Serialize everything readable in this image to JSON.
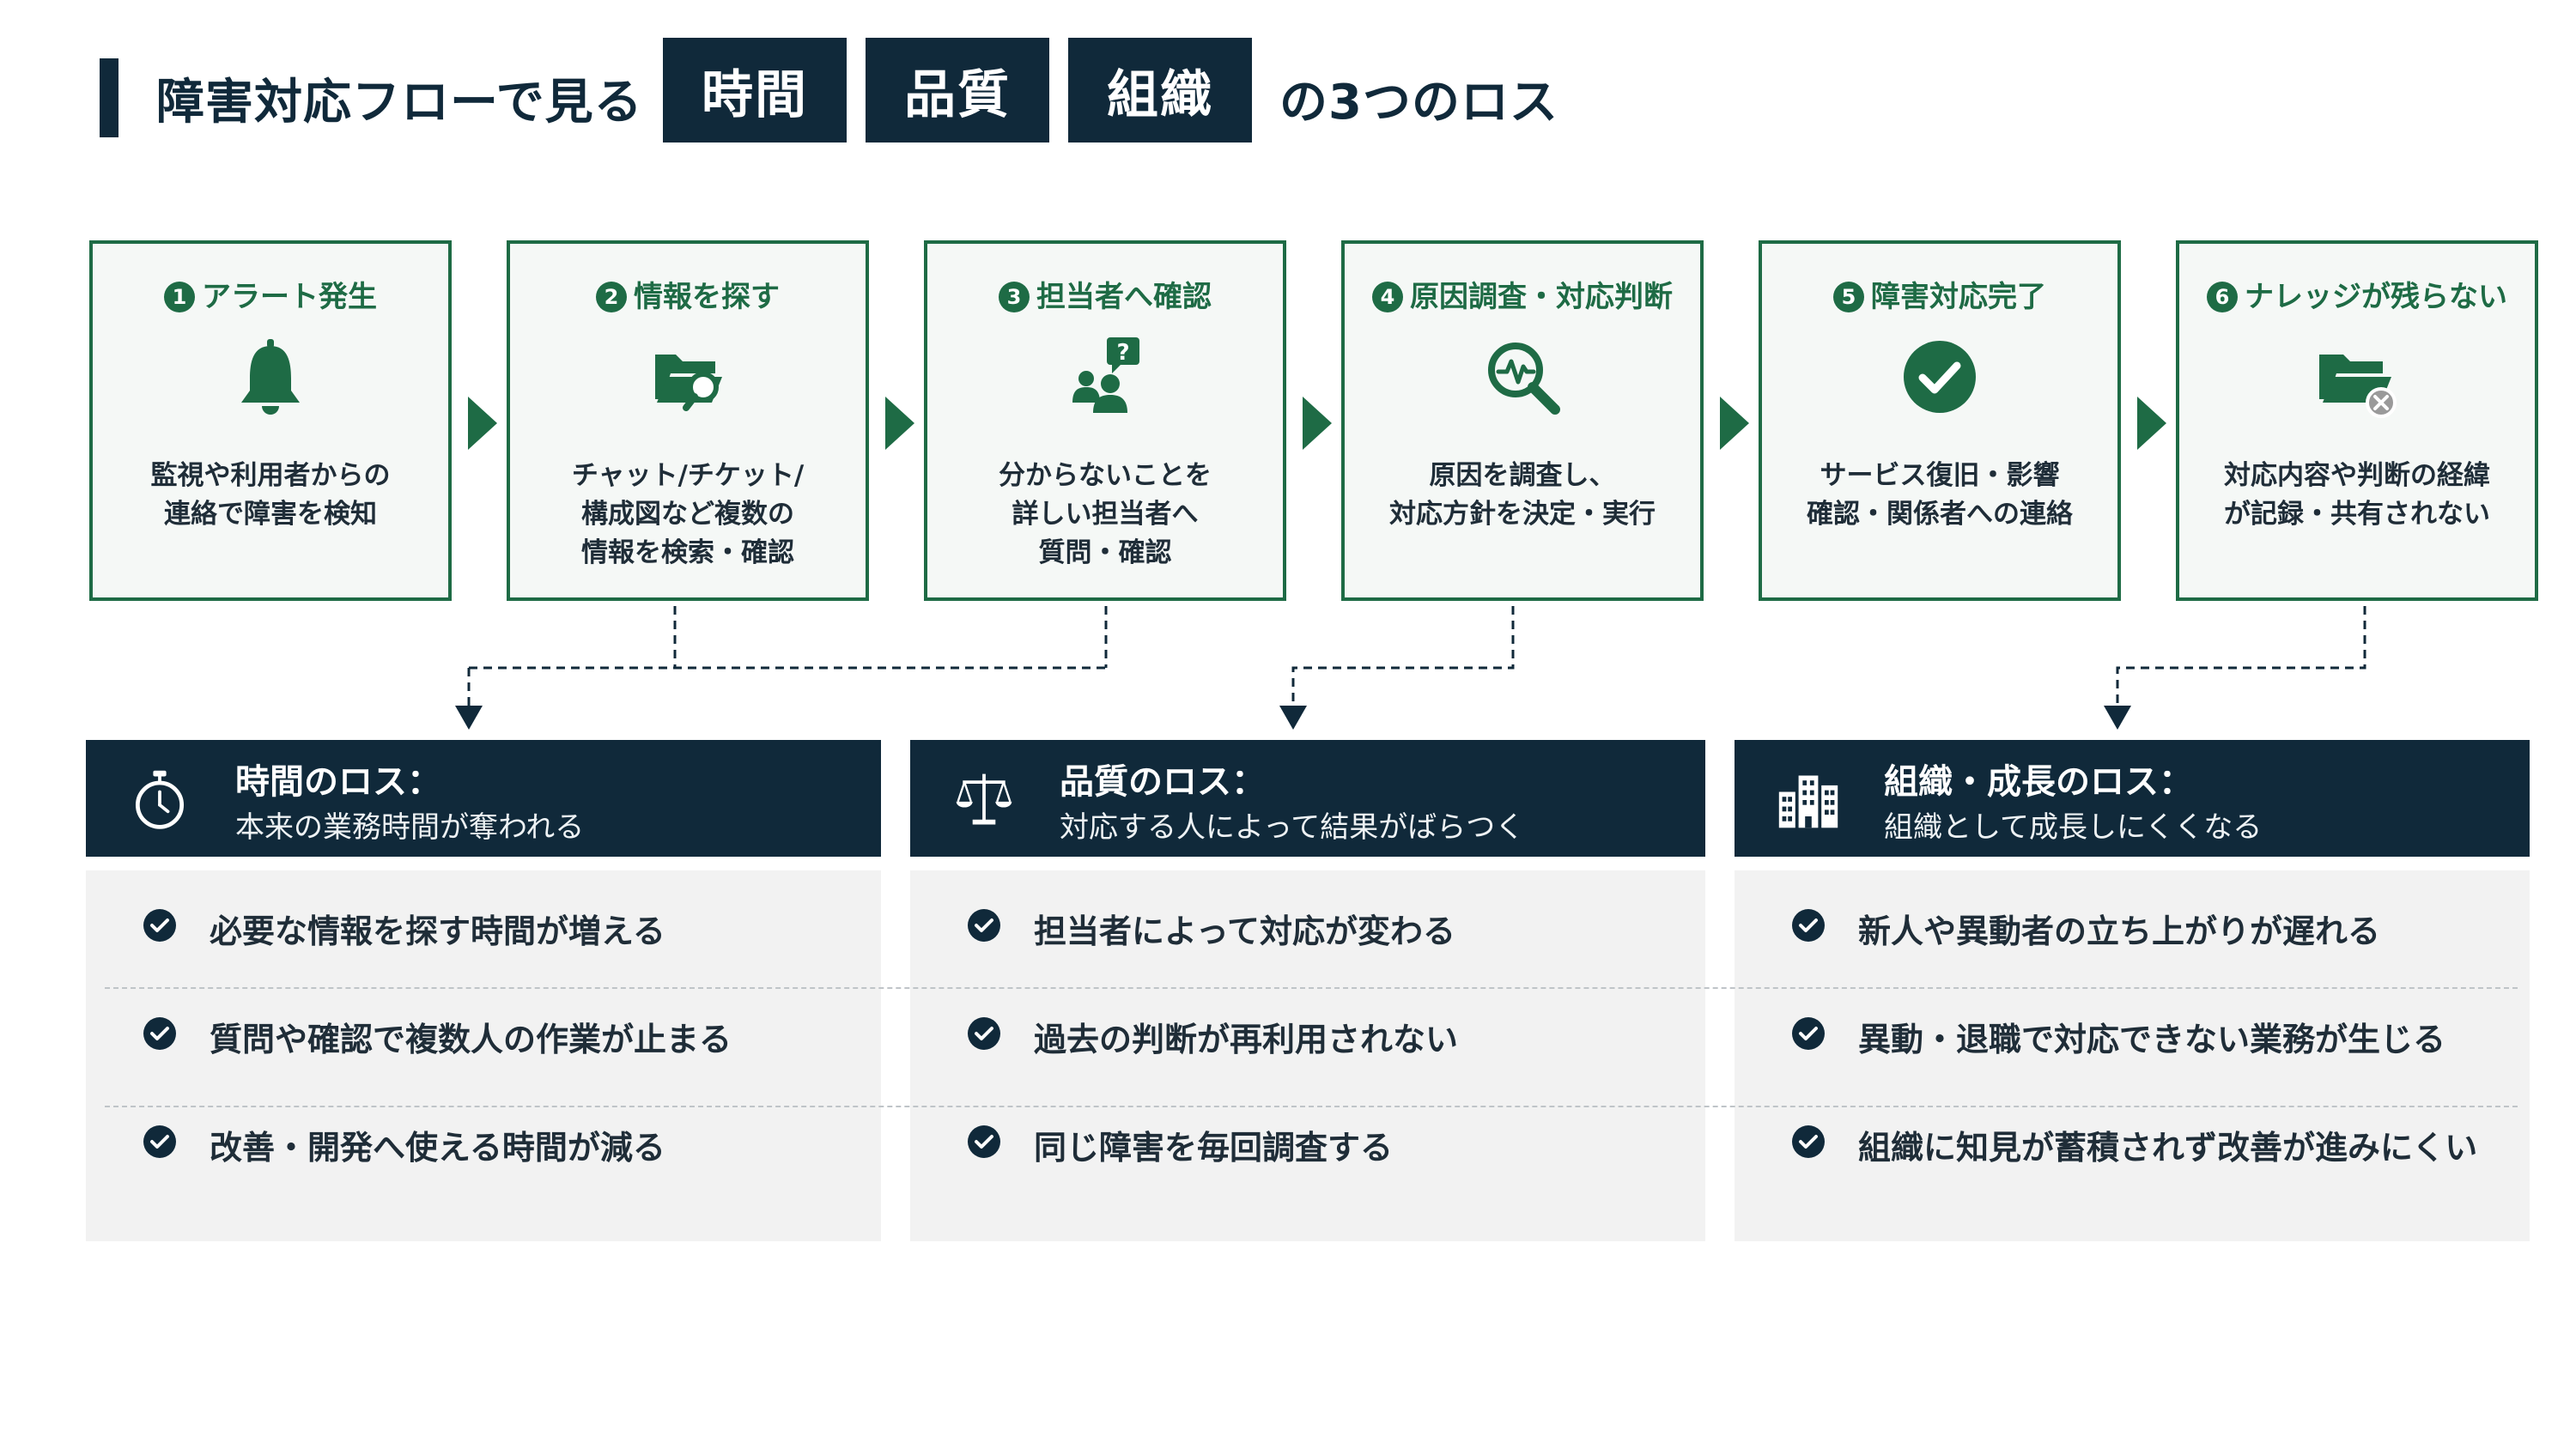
{
  "title": {
    "prefix": "障害対応フローで見る",
    "boxes": [
      "時間",
      "品質",
      "組織"
    ],
    "suffix": "の3つのロス"
  },
  "colors": {
    "navy": "#10293a",
    "green": "#1e6b45",
    "step_bg": "#f5f8f6",
    "card_bg": "#f2f2f2"
  },
  "steps": [
    {
      "num": "1",
      "title": "アラート発生",
      "icon": "bell-icon",
      "desc": [
        "監視や利用者からの",
        "連絡で障害を検知"
      ]
    },
    {
      "num": "2",
      "title": "情報を探す",
      "icon": "folder-search-icon",
      "desc": [
        "チャット/チケット/",
        "構成図など複数の",
        "情報を検索・確認"
      ]
    },
    {
      "num": "3",
      "title": "担当者へ確認",
      "icon": "people-question-icon",
      "desc": [
        "分からないことを",
        "詳しい担当者へ",
        "質問・確認"
      ]
    },
    {
      "num": "4",
      "title": "原因調査・対応判断",
      "icon": "magnifier-pulse-icon",
      "desc": [
        "原因を調査し、",
        "対応方針を決定・実行"
      ]
    },
    {
      "num": "5",
      "title": "障害対応完了",
      "icon": "check-circle-icon",
      "desc": [
        "サービス復旧・影響",
        "確認・関係者への連絡"
      ]
    },
    {
      "num": "6",
      "title": "ナレッジが残らない",
      "icon": "folder-x-icon",
      "desc": [
        "対応内容や判断の経緯",
        "が記録・共有されない"
      ]
    }
  ],
  "losses": [
    {
      "icon": "stopwatch-icon",
      "title": "時間のロス：",
      "subtitle": "本来の業務時間が奪われる",
      "items": [
        "必要な情報を探す時間が増える",
        "質問や確認で複数人の作業が止まる",
        "改善・開発へ使える時間が減る"
      ]
    },
    {
      "icon": "scales-icon",
      "title": "品質のロス：",
      "subtitle": "対応する人によって結果がばらつく",
      "items": [
        "担当者によって対応が変わる",
        "過去の判断が再利用されない",
        "同じ障害を毎回調査する"
      ]
    },
    {
      "icon": "buildings-icon",
      "title": "組織・成長のロス：",
      "subtitle": "組織として成長しにくくなる",
      "items": [
        "新人や異動者の立ち上がりが遅れる",
        "異動・退職で対応できない業務が生じる",
        "組織に知見が蓄積されず改善が進みにくい"
      ]
    }
  ]
}
